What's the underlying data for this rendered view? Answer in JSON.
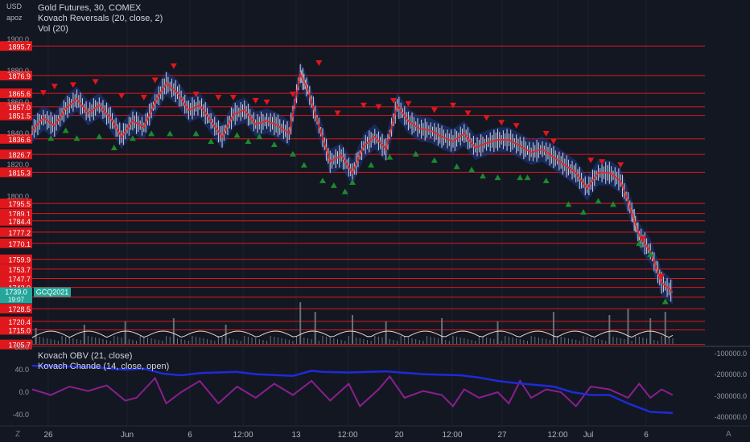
{
  "header": {
    "currency": "USD",
    "user": "apoz",
    "title": "Gold Futures, 30, COMEX",
    "study1": "Kovach Reversals (20, close, 2)",
    "study2": "Vol (20)"
  },
  "indicators": {
    "obv_label": "Kovach OBV (21, close)",
    "chande_label": "Kovach Chande (14, close, open)"
  },
  "axis_toggles": {
    "left": "Z",
    "right": "A"
  },
  "colors": {
    "background": "#131722",
    "level_line": "#e0171c",
    "candle": "#cfd2d6",
    "ma_line": "#e02a2a",
    "band": "#1e3a8a",
    "up_marker": "#1b8a2e",
    "down_marker": "#e0171c",
    "volume": "#6b6f78",
    "volume_ma": "#e8d9c4",
    "obv": "#1e2bd8",
    "chande": "#8a1f8f",
    "price_tag": "#26a69a"
  },
  "chart_data": [
    {
      "type": "line",
      "name": "price",
      "ylim": [
        1705,
        1925
      ],
      "y_ticks": [
        1900.0,
        1880.0,
        1860.0,
        1840.0,
        1820.0,
        1800.0
      ],
      "x_ticks": [
        "26",
        "Jun",
        "6",
        "12:00",
        "13",
        "12:00",
        "20",
        "12:00",
        "27",
        "12:00",
        "Jul",
        "6"
      ],
      "levels": [
        1895.7,
        1876.9,
        1865.6,
        1857.0,
        1851.5,
        1836.6,
        1826.7,
        1815.3,
        1795.5,
        1789.1,
        1784.4,
        1777.2,
        1770.1,
        1759.9,
        1753.7,
        1747.7,
        1742.0,
        1735.8,
        1728.5,
        1720.4,
        1715.0,
        1705.7
      ],
      "level_labels": [
        "1895.7",
        "1876.9",
        "1865.6",
        "1857.0",
        "1851.5",
        "1836.6",
        "1826.7",
        "1815.3",
        "1795.5",
        "1789.1",
        "1784.4",
        "1777.2",
        "1770.1",
        "1759.9",
        "1753.7",
        "1747.7",
        "1742.0",
        "1735.8",
        "1728.5",
        "1720.4",
        "1715.0",
        "1705.7"
      ],
      "tick_labels": [
        "1900.0",
        "1880.0",
        "1860.0",
        "1840.0",
        "1820.0",
        "1800.0"
      ],
      "current_price": "1739.0",
      "current_symbol": "GCQ2021",
      "countdown": "19:07",
      "close_path": [
        [
          0,
          1842
        ],
        [
          3,
          1850
        ],
        [
          6,
          1845
        ],
        [
          9,
          1856
        ],
        [
          12,
          1862
        ],
        [
          15,
          1853
        ],
        [
          18,
          1858
        ],
        [
          21,
          1850
        ],
        [
          24,
          1838
        ],
        [
          27,
          1848
        ],
        [
          30,
          1844
        ],
        [
          33,
          1860
        ],
        [
          36,
          1872
        ],
        [
          39,
          1866
        ],
        [
          42,
          1855
        ],
        [
          45,
          1858
        ],
        [
          48,
          1848
        ],
        [
          51,
          1838
        ],
        [
          54,
          1852
        ],
        [
          57,
          1855
        ],
        [
          60,
          1846
        ],
        [
          63,
          1848
        ],
        [
          66,
          1845
        ],
        [
          69,
          1840
        ],
        [
          72,
          1878
        ],
        [
          74,
          1868
        ],
        [
          77,
          1845
        ],
        [
          80,
          1822
        ],
        [
          83,
          1826
        ],
        [
          86,
          1815
        ],
        [
          89,
          1832
        ],
        [
          92,
          1838
        ],
        [
          95,
          1830
        ],
        [
          98,
          1858
        ],
        [
          101,
          1848
        ],
        [
          104,
          1843
        ],
        [
          107,
          1842
        ],
        [
          110,
          1838
        ],
        [
          113,
          1835
        ],
        [
          116,
          1840
        ],
        [
          119,
          1831
        ],
        [
          122,
          1834
        ],
        [
          125,
          1836
        ],
        [
          128,
          1836
        ],
        [
          131,
          1832
        ],
        [
          134,
          1828
        ],
        [
          137,
          1830
        ],
        [
          140,
          1825
        ],
        [
          143,
          1820
        ],
        [
          146,
          1815
        ],
        [
          149,
          1805
        ],
        [
          152,
          1815
        ],
        [
          155,
          1815
        ],
        [
          158,
          1810
        ],
        [
          161,
          1790
        ],
        [
          163,
          1775
        ],
        [
          166,
          1765
        ],
        [
          169,
          1745
        ],
        [
          172,
          1739
        ]
      ],
      "up_markers": [
        [
          5,
          1842
        ],
        [
          9,
          1847
        ],
        [
          12,
          1842
        ],
        [
          18,
          1843
        ],
        [
          22,
          1836
        ],
        [
          27,
          1842
        ],
        [
          32,
          1845
        ],
        [
          37,
          1845
        ],
        [
          44,
          1845
        ],
        [
          48,
          1840
        ],
        [
          55,
          1844
        ],
        [
          58,
          1840
        ],
        [
          61,
          1843
        ],
        [
          65,
          1838
        ],
        [
          70,
          1832
        ],
        [
          73,
          1825
        ],
        [
          78,
          1815
        ],
        [
          81,
          1812
        ],
        [
          84,
          1808
        ],
        [
          86,
          1814
        ],
        [
          91,
          1825
        ],
        [
          96,
          1830
        ],
        [
          103,
          1832
        ],
        [
          108,
          1828
        ],
        [
          114,
          1824
        ],
        [
          118,
          1822
        ],
        [
          121,
          1818
        ],
        [
          125,
          1817
        ],
        [
          131,
          1817
        ],
        [
          133,
          1817
        ],
        [
          138,
          1815
        ],
        [
          144,
          1800
        ],
        [
          148,
          1795
        ],
        [
          152,
          1802
        ],
        [
          156,
          1800
        ],
        [
          163,
          1775
        ],
        [
          166,
          1768
        ],
        [
          170,
          1738
        ]
      ],
      "down_markers": [
        [
          3,
          1861
        ],
        [
          6,
          1865
        ],
        [
          11,
          1866
        ],
        [
          17,
          1868
        ],
        [
          24,
          1859
        ],
        [
          30,
          1858
        ],
        [
          33,
          1869
        ],
        [
          38,
          1878
        ],
        [
          44,
          1860
        ],
        [
          50,
          1858
        ],
        [
          54,
          1858
        ],
        [
          60,
          1856
        ],
        [
          63,
          1855
        ],
        [
          70,
          1860
        ],
        [
          77,
          1880
        ],
        [
          82,
          1848
        ],
        [
          89,
          1853
        ],
        [
          93,
          1852
        ],
        [
          97,
          1856
        ],
        [
          101,
          1854
        ],
        [
          108,
          1850
        ],
        [
          113,
          1853
        ],
        [
          117,
          1848
        ],
        [
          122,
          1845
        ],
        [
          126,
          1842
        ],
        [
          130,
          1840
        ],
        [
          138,
          1835
        ],
        [
          140,
          1830
        ],
        [
          150,
          1818
        ],
        [
          153,
          1817
        ],
        [
          158,
          1815
        ],
        [
          164,
          1768
        ],
        [
          169,
          1744
        ]
      ],
      "volume_spikes": [
        [
          1,
          0.25
        ],
        [
          14,
          0.3
        ],
        [
          25,
          0.35
        ],
        [
          38,
          0.4
        ],
        [
          52,
          0.3
        ],
        [
          72,
          0.65
        ],
        [
          76,
          0.5
        ],
        [
          86,
          0.45
        ],
        [
          95,
          0.35
        ],
        [
          110,
          0.4
        ],
        [
          125,
          0.35
        ],
        [
          140,
          0.5
        ],
        [
          155,
          0.45
        ],
        [
          160,
          0.55
        ],
        [
          166,
          0.4
        ],
        [
          170,
          0.5
        ]
      ]
    },
    {
      "type": "line",
      "name": "kovach",
      "ylim": [
        -60,
        80
      ],
      "y_ticks": [
        80.0,
        40.0,
        0.0,
        -40.0
      ],
      "tick_labels": [
        "80.0",
        "40.0",
        "0.0",
        "-40.0"
      ],
      "right_ticks": [
        "-100000.0",
        "-200000.0",
        "-300000.0",
        "-400000.0"
      ],
      "obv_path": [
        [
          0,
          47
        ],
        [
          15,
          45
        ],
        [
          25,
          40
        ],
        [
          30,
          42
        ],
        [
          35,
          33
        ],
        [
          40,
          30
        ],
        [
          45,
          34
        ],
        [
          55,
          36
        ],
        [
          60,
          32
        ],
        [
          70,
          29
        ],
        [
          75,
          38
        ],
        [
          78,
          36
        ],
        [
          85,
          35
        ],
        [
          95,
          37
        ],
        [
          105,
          32
        ],
        [
          115,
          30
        ],
        [
          120,
          26
        ],
        [
          125,
          20
        ],
        [
          130,
          16
        ],
        [
          140,
          10
        ],
        [
          145,
          0
        ],
        [
          150,
          -5
        ],
        [
          155,
          -5
        ],
        [
          160,
          -20
        ],
        [
          166,
          -35
        ],
        [
          172,
          -37
        ]
      ],
      "chande_path": [
        [
          0,
          5
        ],
        [
          5,
          -5
        ],
        [
          10,
          10
        ],
        [
          15,
          2
        ],
        [
          20,
          12
        ],
        [
          25,
          -15
        ],
        [
          28,
          -10
        ],
        [
          33,
          25
        ],
        [
          36,
          -20
        ],
        [
          40,
          0
        ],
        [
          45,
          20
        ],
        [
          50,
          -20
        ],
        [
          55,
          10
        ],
        [
          60,
          -10
        ],
        [
          65,
          15
        ],
        [
          70,
          -5
        ],
        [
          75,
          20
        ],
        [
          80,
          -15
        ],
        [
          85,
          15
        ],
        [
          88,
          -25
        ],
        [
          93,
          5
        ],
        [
          96,
          28
        ],
        [
          100,
          -10
        ],
        [
          105,
          2
        ],
        [
          110,
          -5
        ],
        [
          113,
          -25
        ],
        [
          116,
          5
        ],
        [
          120,
          -10
        ],
        [
          125,
          0
        ],
        [
          128,
          -20
        ],
        [
          131,
          20
        ],
        [
          134,
          -10
        ],
        [
          138,
          5
        ],
        [
          142,
          0
        ],
        [
          146,
          -25
        ],
        [
          150,
          10
        ],
        [
          155,
          5
        ],
        [
          160,
          -10
        ],
        [
          163,
          15
        ],
        [
          166,
          -10
        ],
        [
          169,
          5
        ],
        [
          172,
          -5
        ]
      ]
    }
  ]
}
